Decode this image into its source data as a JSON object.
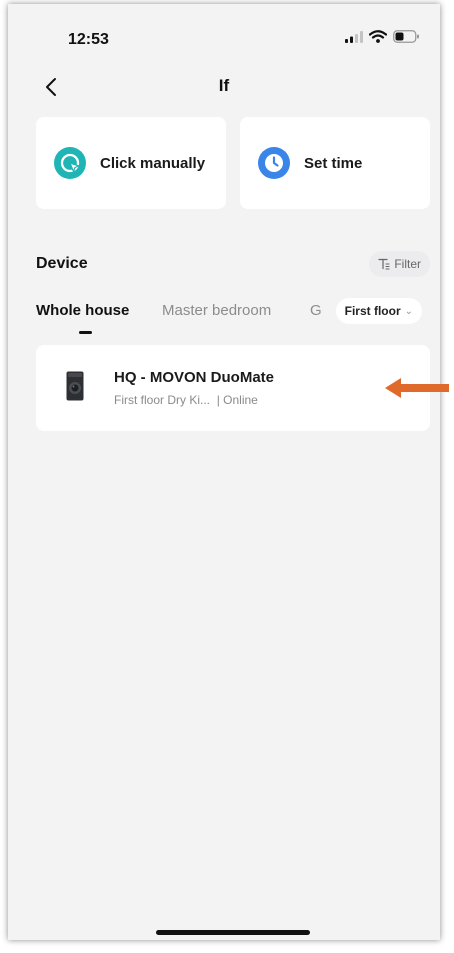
{
  "status_bar": {
    "time": "12:53"
  },
  "header": {
    "title": "If",
    "back_icon": "chevron-left-icon"
  },
  "triggers": [
    {
      "label": "Click manually",
      "icon": "tap-cursor-icon",
      "color": "#1fb5b4"
    },
    {
      "label": "Set time",
      "icon": "clock-icon",
      "color": "#3a86e8"
    }
  ],
  "device_section": {
    "title": "Device",
    "filter_label": "Filter",
    "tabs": [
      {
        "label": "Whole house",
        "active": true
      },
      {
        "label": "Master bedroom",
        "active": false
      },
      {
        "label": "G",
        "active": false
      }
    ],
    "floor_select": "First floor"
  },
  "devices": [
    {
      "name": "HQ - MOVON DuoMate",
      "location": "First floor Dry Ki...",
      "status": "| Online"
    }
  ],
  "colors": {
    "background": "#f3f3f4",
    "card": "#ffffff",
    "annotation_arrow": "#e06a2c"
  }
}
